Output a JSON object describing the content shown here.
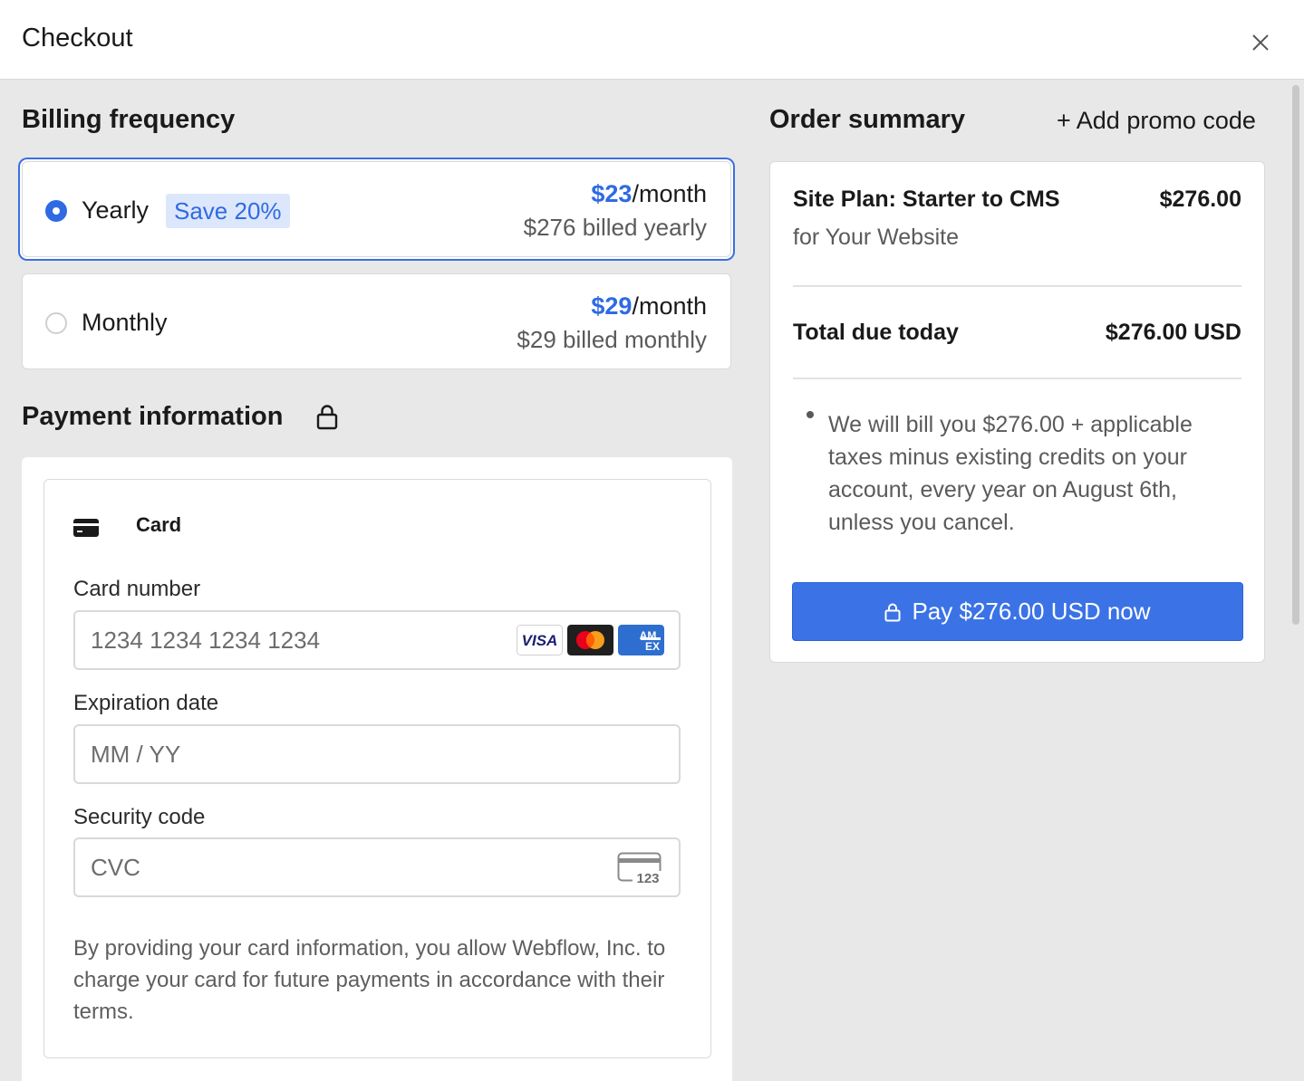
{
  "header": {
    "title": "Checkout"
  },
  "billing": {
    "heading": "Billing frequency",
    "options": [
      {
        "label": "Yearly",
        "badge": "Save 20%",
        "price": "$23",
        "per": "/month",
        "billed": "$276 billed yearly",
        "selected": true
      },
      {
        "label": "Monthly",
        "price": "$29",
        "per": "/month",
        "billed": "$29 billed monthly",
        "selected": false
      }
    ]
  },
  "payment": {
    "heading": "Payment information",
    "tab_label": "Card",
    "card_number": {
      "label": "Card number",
      "placeholder": "1234 1234 1234 1234"
    },
    "expiration": {
      "label": "Expiration date",
      "placeholder": "MM / YY"
    },
    "security": {
      "label": "Security code",
      "placeholder": "CVC",
      "icon_text": "123"
    },
    "brands": [
      "VISA",
      "Mastercard",
      "AMEX"
    ],
    "legal": "By providing your card information, you allow Webflow, Inc. to charge your card for future payments in accordance with their terms."
  },
  "summary": {
    "heading": "Order summary",
    "promo": "+ Add promo code",
    "item_name": "Site Plan: Starter to CMS",
    "item_sub": "for Your Website",
    "item_price": "$276.00",
    "total_label": "Total due today",
    "total_value": "$276.00 USD",
    "note": "We will bill you $276.00 + applicable taxes minus existing credits on your account, every year on August 6th, unless you cancel.",
    "pay_button": "Pay $276.00 USD now"
  },
  "colors": {
    "accent": "#2f6ae3",
    "button": "#3b73e6",
    "background": "#e8e8e8"
  }
}
